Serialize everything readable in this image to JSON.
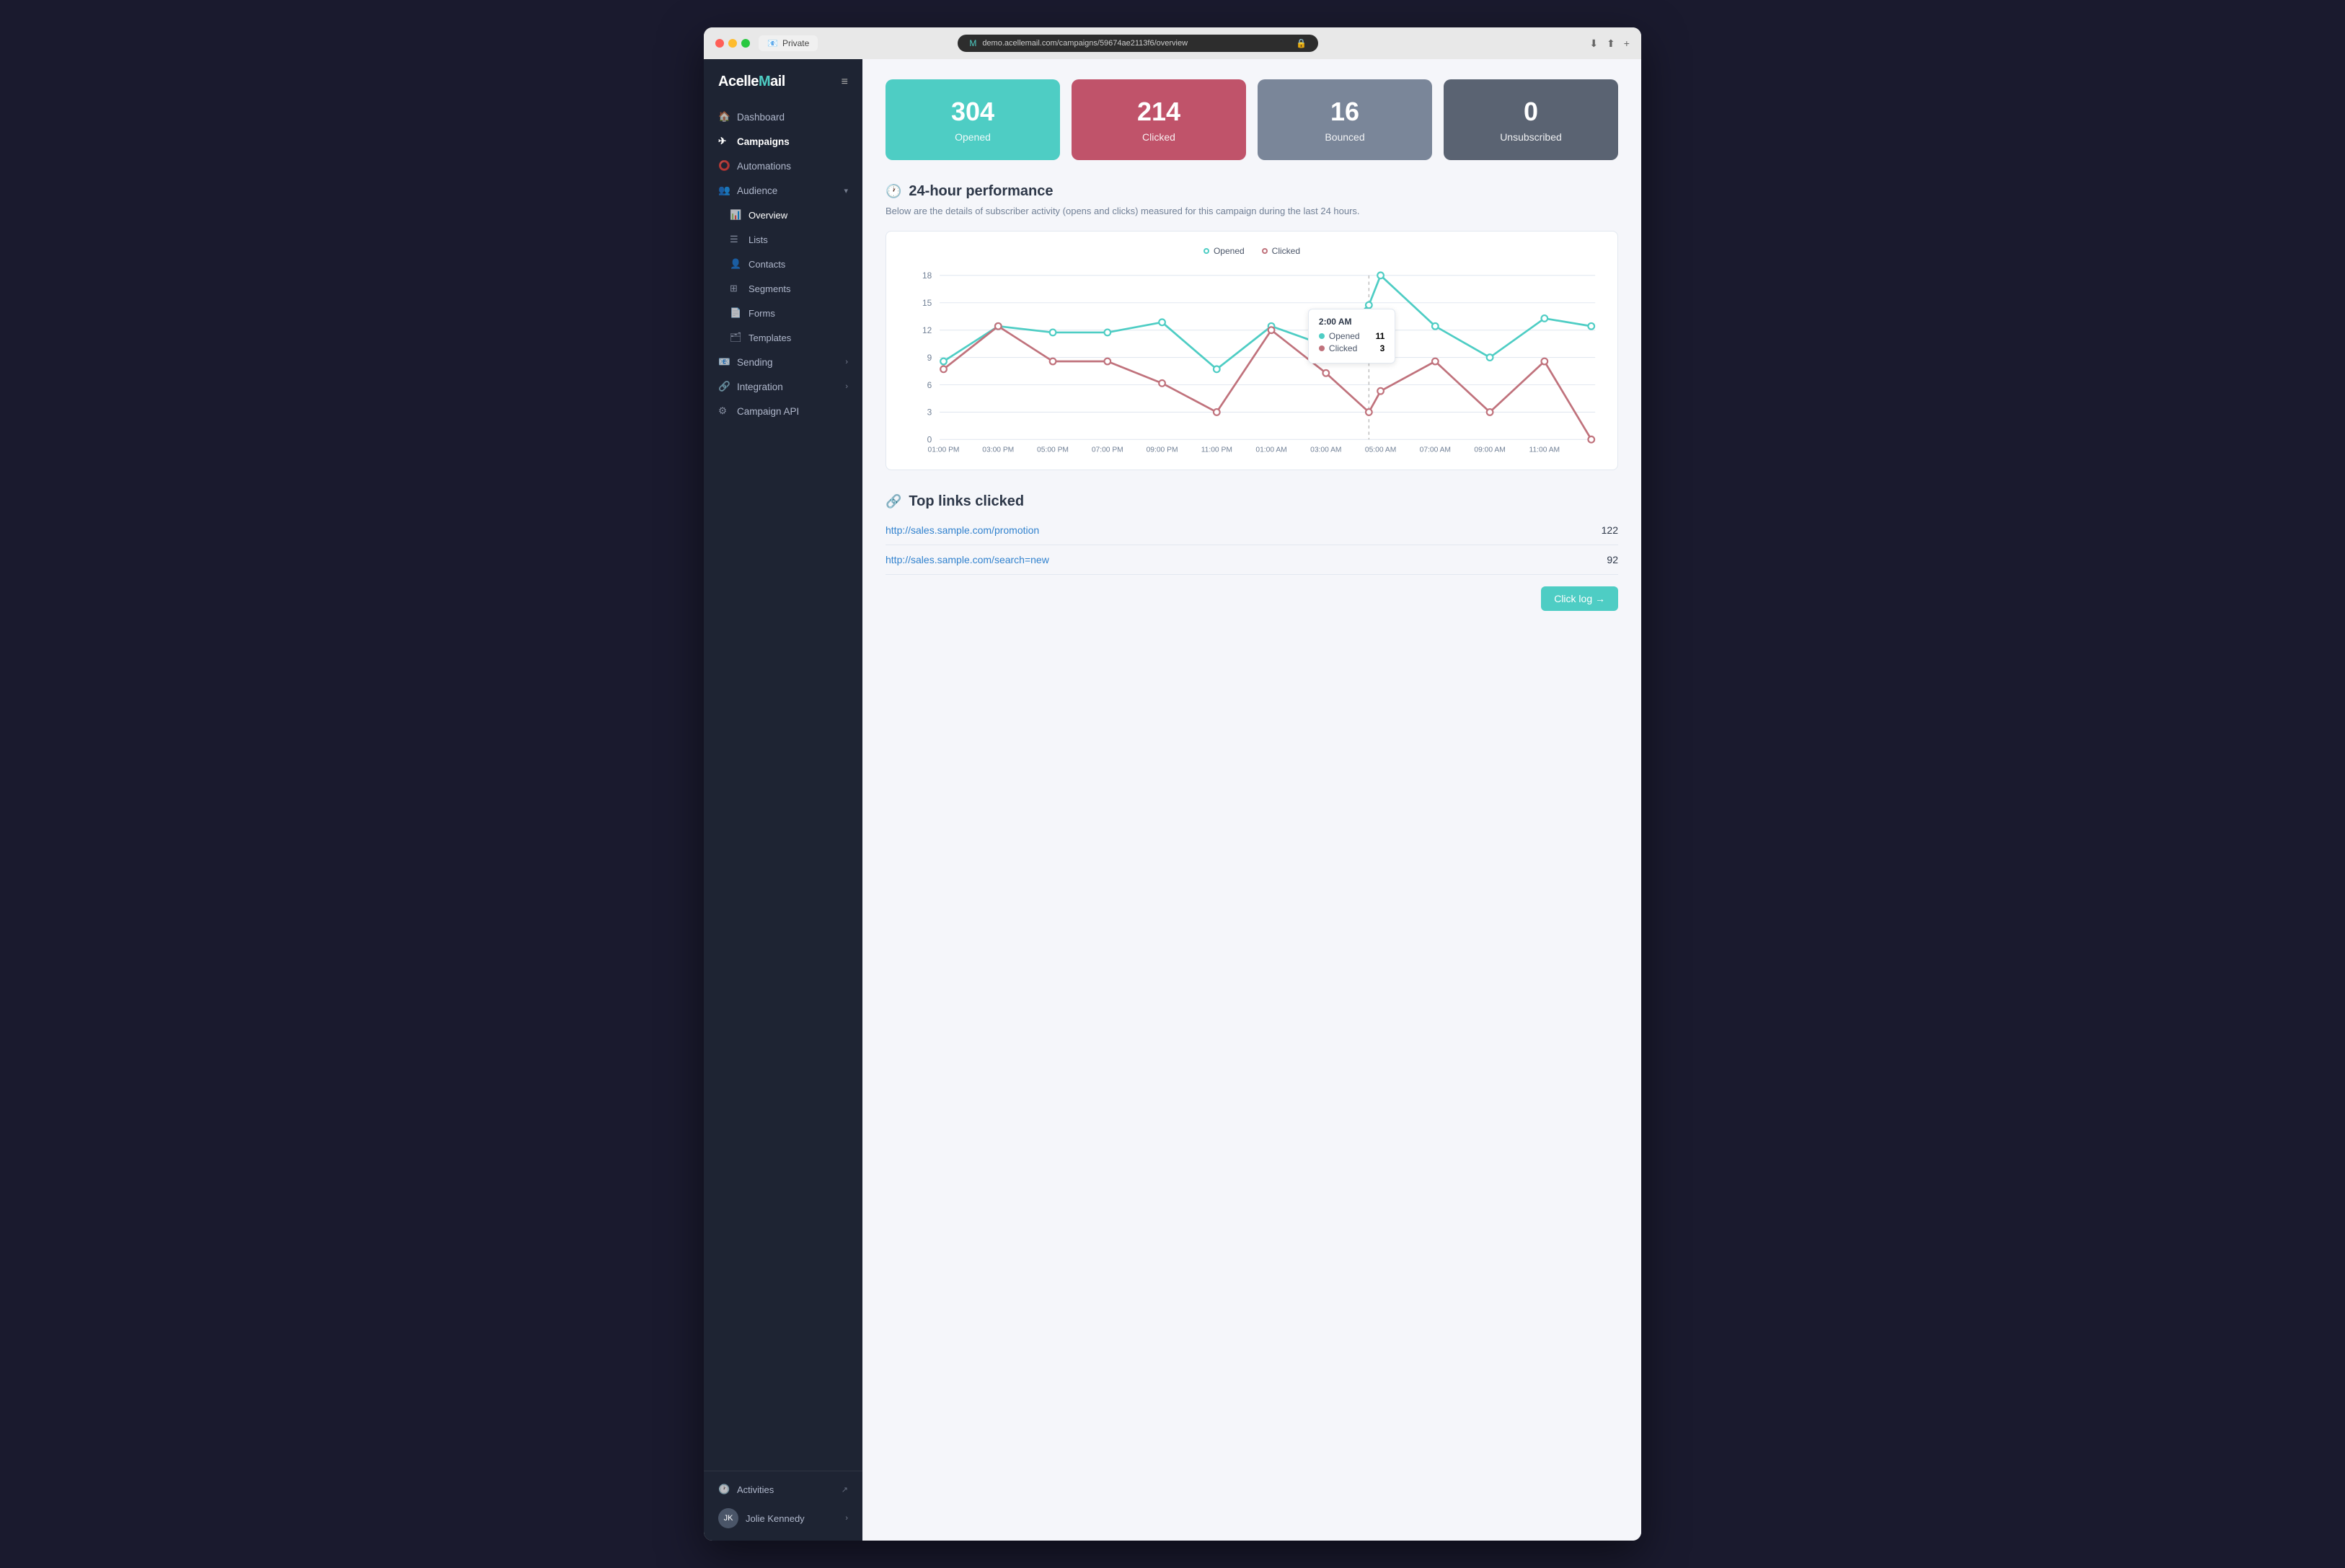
{
  "browser": {
    "tab_label": "Private",
    "address": "demo.acellemail.com/campaigns/59674ae2113f6/overview",
    "nav_back": "‹",
    "nav_refresh": "↻"
  },
  "sidebar": {
    "logo": "Acelle Mail",
    "menu_icon": "≡",
    "nav_items": [
      {
        "id": "dashboard",
        "label": "Dashboard",
        "icon": "home"
      },
      {
        "id": "campaigns",
        "label": "Campaigns",
        "icon": "send",
        "active": true
      },
      {
        "id": "automations",
        "label": "Automations",
        "icon": "circle"
      },
      {
        "id": "audience",
        "label": "Audience",
        "icon": "users",
        "has_chevron": true
      },
      {
        "id": "overview",
        "label": "Overview",
        "icon": "bar-chart",
        "sub": true
      },
      {
        "id": "lists",
        "label": "Lists",
        "icon": "list",
        "sub": true
      },
      {
        "id": "contacts",
        "label": "Contacts",
        "icon": "person",
        "sub": true
      },
      {
        "id": "segments",
        "label": "Segments",
        "icon": "grid",
        "sub": true
      },
      {
        "id": "forms",
        "label": "Forms",
        "icon": "file",
        "sub": true
      },
      {
        "id": "templates",
        "label": "Templates",
        "icon": "layout",
        "sub": true
      },
      {
        "id": "sending",
        "label": "Sending",
        "icon": "mail",
        "has_chevron": true
      },
      {
        "id": "integration",
        "label": "Integration",
        "icon": "plug",
        "has_chevron": true
      },
      {
        "id": "campaign-api",
        "label": "Campaign API",
        "icon": "code"
      }
    ],
    "bottom": {
      "activities_label": "Activities",
      "activities_icon": "clock",
      "user_name": "Jolie Kennedy",
      "user_initials": "JK"
    }
  },
  "stats": [
    {
      "id": "opened",
      "value": "304",
      "label": "Opened",
      "color": "teal"
    },
    {
      "id": "clicked",
      "value": "214",
      "label": "Clicked",
      "color": "pink"
    },
    {
      "id": "bounced",
      "value": "16",
      "label": "Bounced",
      "color": "gray-mid"
    },
    {
      "id": "unsubscribed",
      "value": "0",
      "label": "Unsubscribed",
      "color": "gray-dark"
    }
  ],
  "performance": {
    "section_icon": "clock",
    "title": "24-hour performance",
    "description": "Below are the details of subscriber activity (opens and clicks) measured for this campaign during the last 24 hours.",
    "legend": {
      "opened": "Opened",
      "clicked": "Clicked"
    },
    "tooltip": {
      "time": "2:00 AM",
      "opened_label": "Opened",
      "opened_value": "11",
      "clicked_label": "Clicked",
      "clicked_value": "3"
    },
    "y_labels": [
      "0",
      "3",
      "6",
      "9",
      "12",
      "15",
      "18"
    ],
    "x_labels": [
      "01:00 PM",
      "03:00 PM",
      "05:00 PM",
      "07:00 PM",
      "09:00 PM",
      "11:00 PM",
      "01:00 AM",
      "03:00 AM",
      "05:00 AM",
      "07:00 AM",
      "09:00 AM",
      "11:00 AM"
    ]
  },
  "top_links": {
    "section_icon": "link",
    "title": "Top links clicked",
    "links": [
      {
        "url": "http://sales.sample.com/promotion",
        "count": "122"
      },
      {
        "url": "http://sales.sample.com/search=new",
        "count": "92"
      }
    ],
    "click_log_button": "Click log →"
  }
}
